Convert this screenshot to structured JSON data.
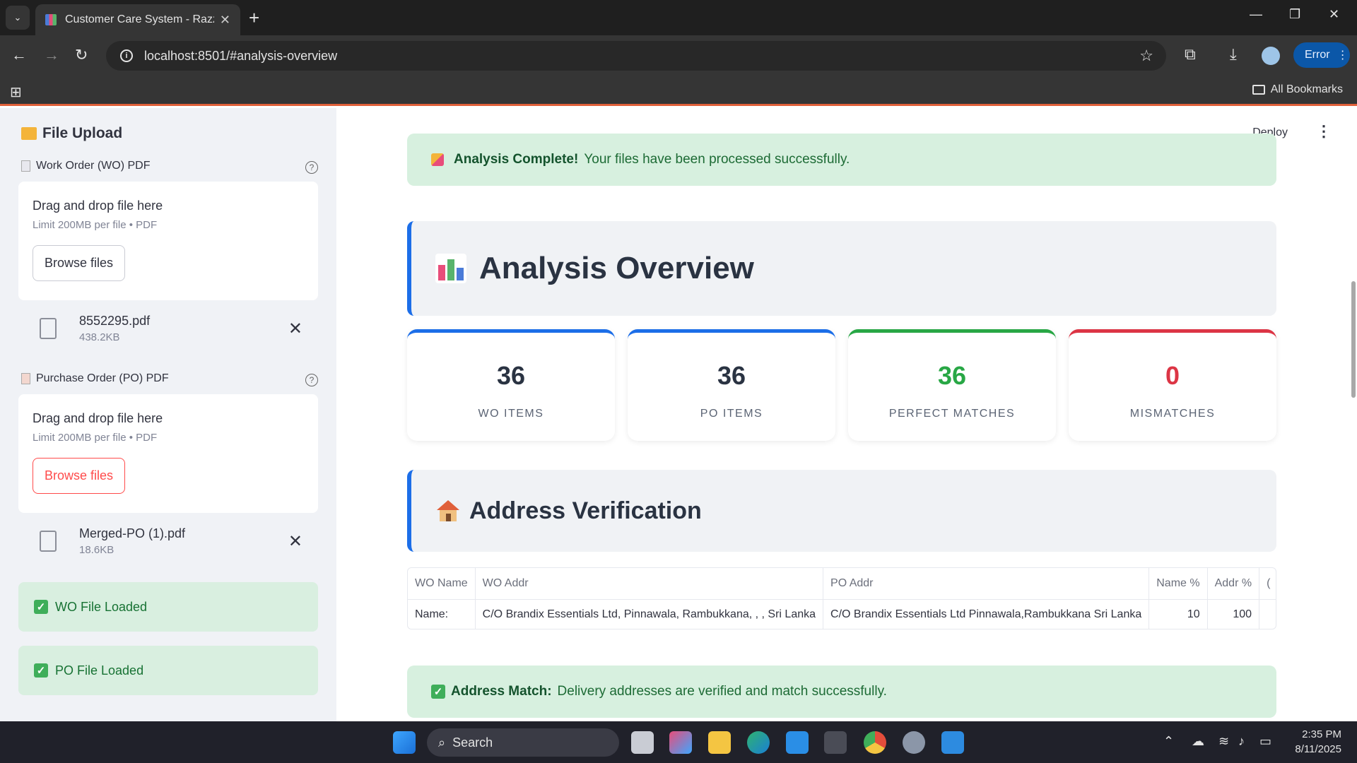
{
  "browser": {
    "tab_title": "Customer Care System - Razz S",
    "url": "localhost:8501/#analysis-overview",
    "profile_button": "Error",
    "bookmarks_label": "All Bookmarks"
  },
  "sidebar": {
    "title": "File Upload",
    "wo_label": "Work Order (WO) PDF",
    "po_label": "Purchase Order (PO) PDF",
    "dropzone_title": "Drag and drop file here",
    "dropzone_limit": "Limit 200MB per file • PDF",
    "browse_label": "Browse files",
    "wo_file": {
      "name": "8552295.pdf",
      "size": "438.2KB"
    },
    "po_file": {
      "name": "Merged-PO (1).pdf",
      "size": "18.6KB"
    },
    "wo_loaded": "WO File Loaded",
    "po_loaded": "PO File Loaded"
  },
  "header": {
    "deploy": "Deploy",
    "menu_icon": "kebab-menu-icon"
  },
  "banner_top": {
    "bold": "Analysis Complete!",
    "text": "Your files have been processed successfully."
  },
  "overview": {
    "title": "Analysis Overview"
  },
  "metrics": [
    {
      "value": "36",
      "label": "WO ITEMS",
      "color": "#1c6ee8",
      "value_color": "#2a3342"
    },
    {
      "value": "36",
      "label": "PO ITEMS",
      "color": "#1c6ee8",
      "value_color": "#2a3342"
    },
    {
      "value": "36",
      "label": "PERFECT MATCHES",
      "color": "#28a745",
      "value_color": "#28a745"
    },
    {
      "value": "0",
      "label": "MISMATCHES",
      "color": "#dc3545",
      "value_color": "#dc3545"
    }
  ],
  "address": {
    "title": "Address Verification",
    "columns": [
      "WO Name",
      "WO Addr",
      "PO Addr",
      "Name %",
      "Addr %",
      "("
    ],
    "row": [
      "Name:",
      "C/O Brandix Essentials Ltd, Pinnawala, Rambukkana, , , Sri Lanka",
      "C/O Brandix Essentials Ltd Pinnawala,Rambukkana Sri Lanka",
      "10",
      "100",
      ""
    ]
  },
  "banner_bottom": {
    "bold": "Address Match:",
    "text": "Delivery addresses are verified and match successfully."
  },
  "taskbar": {
    "search": "Search",
    "time": "2:35 PM",
    "date": "8/11/2025"
  }
}
